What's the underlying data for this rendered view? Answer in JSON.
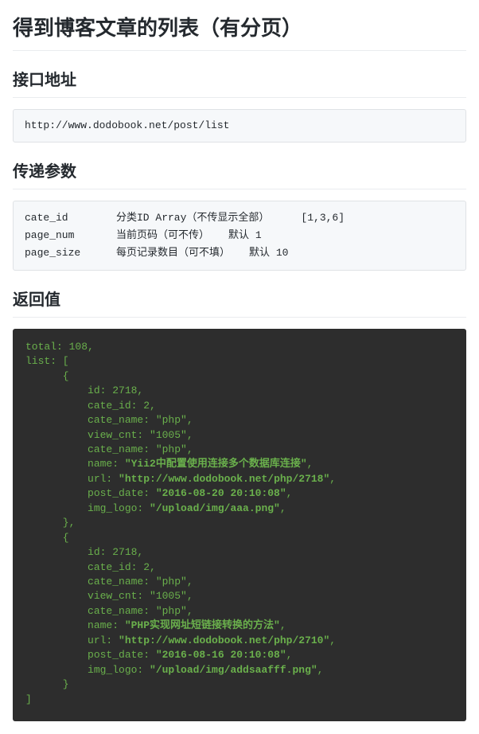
{
  "title": "得到博客文章的列表（有分页）",
  "sections": {
    "endpoint_heading": "接口地址",
    "params_heading": "传递参数",
    "return_heading": "返回值"
  },
  "endpoint": "http://www.dodobook.net/post/list",
  "params": [
    {
      "name": "cate_id",
      "desc": "分类ID Array（不传显示全部）",
      "default": "",
      "example": "[1,3,6]"
    },
    {
      "name": "page_num",
      "desc": "当前页码（可不传）",
      "default": "默认 1",
      "example": ""
    },
    {
      "name": "page_size",
      "desc": "每页记录数目（可不填）",
      "default": "默认 10",
      "example": ""
    }
  ],
  "return_value": {
    "total": 108,
    "list": [
      {
        "id": 2718,
        "cate_id": 2,
        "cate_name": "php",
        "view_cnt": "1005",
        "cate_name2": "php",
        "name": "Yii2中配置使用连接多个数据库连接",
        "url": "http://www.dodobook.net/php/2718",
        "post_date": "2016-08-20 20:10:08",
        "img_logo": "/upload/img/aaa.png"
      },
      {
        "id": 2718,
        "cate_id": 2,
        "cate_name": "php",
        "view_cnt": "1005",
        "cate_name2": "php",
        "name": "PHP实现网址短链接转换的方法",
        "url": "http://www.dodobook.net/php/2710",
        "post_date": "2016-08-16 20:10:08",
        "img_logo": "/upload/img/addsaafff.png"
      }
    ]
  }
}
